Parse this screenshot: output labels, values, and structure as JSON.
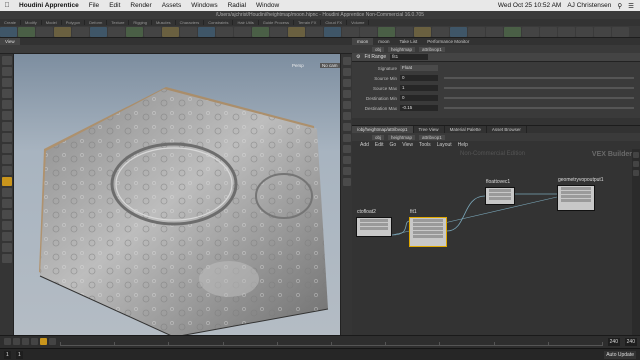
{
  "mac_menubar": {
    "apple": "",
    "app_name": "Houdini Apprentice",
    "items": [
      "File",
      "Edit",
      "Render",
      "Assets",
      "Windows",
      "Radial",
      "Window"
    ],
    "clock": "Wed Oct 25  10:52 AM",
    "user": "AJ Christensen"
  },
  "window_title": "/Users/ajchrist/Houdini/heightmap/moon.hipnc - Houdini Apprentice Non-Commercial 16.0.705",
  "shelf_tabs": [
    "Create",
    "Modify",
    "Model",
    "Polygon",
    "Deform",
    "Texture",
    "Rigging",
    "Muscles",
    "Characters",
    "Constraints",
    "Hair Utils",
    "Guide Process",
    "Terrain FX",
    "Cloud FX",
    "Volume"
  ],
  "viewport": {
    "tab": "View",
    "persp_label": "Persp",
    "cam_label": "No cam"
  },
  "params_pane": {
    "tabs": [
      "moon",
      "moon",
      "Take List",
      "Performance Monitor"
    ],
    "path": [
      "obj",
      "heightmap",
      "attribvop1"
    ],
    "node_type": "Fit Range",
    "node_name": "fit1",
    "rows": [
      {
        "label": "Signature",
        "value": "Float"
      },
      {
        "label": "Source Min",
        "value": "0"
      },
      {
        "label": "Source Max",
        "value": "1"
      },
      {
        "label": "Destination Min",
        "value": "0"
      },
      {
        "label": "Destination Max",
        "value": "-0.15"
      }
    ]
  },
  "network_pane": {
    "tabs": [
      "/obj/heightmap/attribvop1",
      "Tree View",
      "Material Palette",
      "Asset Browser"
    ],
    "path": [
      "obj",
      "heightmap",
      "attribvop1"
    ],
    "menu": [
      "Add",
      "Edit",
      "Go",
      "View",
      "Tools",
      "Layout",
      "Help"
    ],
    "watermark": "Non-Commercial Edition",
    "context_label": "VEX Builder",
    "nodes": [
      {
        "name": "floattovec1",
        "rows": 3
      },
      {
        "name": "geometryvopoutput1",
        "rows": 4
      },
      {
        "name": "ctofloat2",
        "rows": 3
      },
      {
        "name": "fit1",
        "rows": 5
      }
    ]
  },
  "timeline": {
    "frame": "1",
    "start": "1",
    "end": "240",
    "range_end": "240",
    "ticks": [
      "1",
      "24",
      "48",
      "72",
      "96",
      "120",
      "144",
      "168",
      "192",
      "216",
      "240"
    ],
    "auto_update": "Auto Update"
  }
}
